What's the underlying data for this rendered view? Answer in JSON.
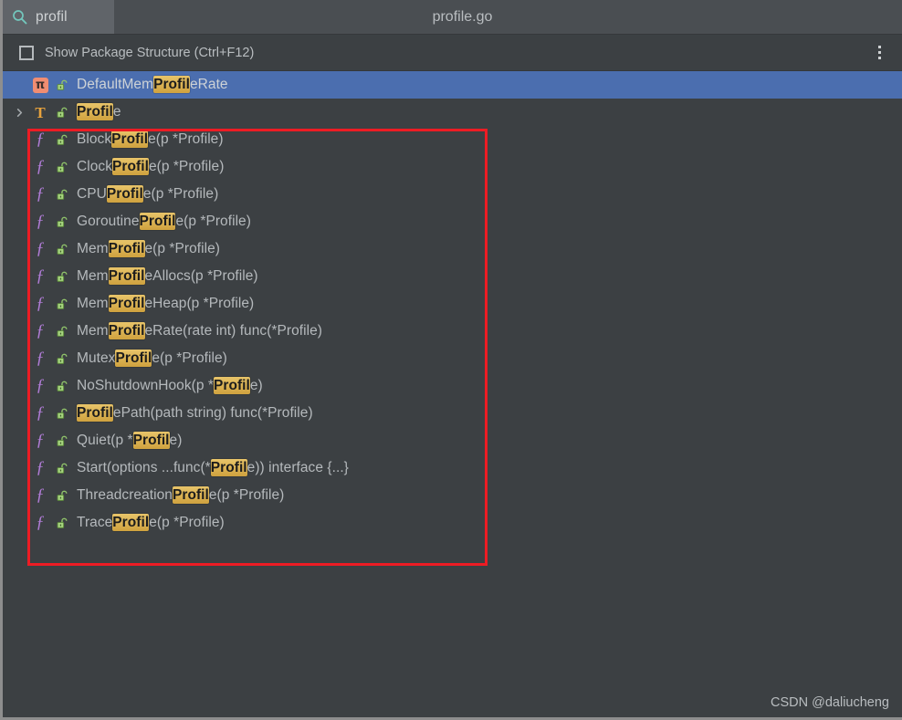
{
  "window": {
    "file_title": "profile.go",
    "background_color": "#3c4043"
  },
  "search": {
    "icon": "search-icon",
    "value": "profil",
    "placeholder": "Search"
  },
  "toolbar": {
    "checkbox_label": "Show Package Structure (Ctrl+F12)",
    "checkbox_checked": false,
    "menu_icon": "kebab-menu-icon"
  },
  "highlight_term": "Profil",
  "tree": {
    "rows": [
      {
        "kind": "constant",
        "icon": "pi-constant-icon",
        "lock": "unlock-icon",
        "twisty": "",
        "selected": true,
        "parts": [
          {
            "t": "DefaultMem",
            "h": false
          },
          {
            "t": "Profil",
            "h": true
          },
          {
            "t": "eRate",
            "h": false
          }
        ]
      },
      {
        "kind": "type",
        "icon": "type-t-icon",
        "lock": "unlock-icon",
        "twisty": "chevron-right-icon",
        "selected": false,
        "parts": [
          {
            "t": "Profil",
            "h": true
          },
          {
            "t": "e",
            "h": false
          }
        ]
      },
      {
        "kind": "function",
        "icon": "function-f-icon",
        "lock": "unlock-icon",
        "twisty": "",
        "selected": false,
        "parts": [
          {
            "t": "Block",
            "h": false
          },
          {
            "t": "Profil",
            "h": true
          },
          {
            "t": "e(p *Profile)",
            "h": false
          }
        ]
      },
      {
        "kind": "function",
        "icon": "function-f-icon",
        "lock": "unlock-icon",
        "twisty": "",
        "selected": false,
        "parts": [
          {
            "t": "Clock",
            "h": false
          },
          {
            "t": "Profil",
            "h": true
          },
          {
            "t": "e(p *Profile)",
            "h": false
          }
        ]
      },
      {
        "kind": "function",
        "icon": "function-f-icon",
        "lock": "unlock-icon",
        "twisty": "",
        "selected": false,
        "parts": [
          {
            "t": "CPU",
            "h": false
          },
          {
            "t": "Profil",
            "h": true
          },
          {
            "t": "e(p *Profile)",
            "h": false
          }
        ]
      },
      {
        "kind": "function",
        "icon": "function-f-icon",
        "lock": "unlock-icon",
        "twisty": "",
        "selected": false,
        "parts": [
          {
            "t": "Goroutine",
            "h": false
          },
          {
            "t": "Profil",
            "h": true
          },
          {
            "t": "e(p *Profile)",
            "h": false
          }
        ]
      },
      {
        "kind": "function",
        "icon": "function-f-icon",
        "lock": "unlock-icon",
        "twisty": "",
        "selected": false,
        "parts": [
          {
            "t": "Mem",
            "h": false
          },
          {
            "t": "Profil",
            "h": true
          },
          {
            "t": "e(p *Profile)",
            "h": false
          }
        ]
      },
      {
        "kind": "function",
        "icon": "function-f-icon",
        "lock": "unlock-icon",
        "twisty": "",
        "selected": false,
        "parts": [
          {
            "t": "Mem",
            "h": false
          },
          {
            "t": "Profil",
            "h": true
          },
          {
            "t": "eAllocs(p *Profile)",
            "h": false
          }
        ]
      },
      {
        "kind": "function",
        "icon": "function-f-icon",
        "lock": "unlock-icon",
        "twisty": "",
        "selected": false,
        "parts": [
          {
            "t": "Mem",
            "h": false
          },
          {
            "t": "Profil",
            "h": true
          },
          {
            "t": "eHeap(p *Profile)",
            "h": false
          }
        ]
      },
      {
        "kind": "function",
        "icon": "function-f-icon",
        "lock": "unlock-icon",
        "twisty": "",
        "selected": false,
        "parts": [
          {
            "t": "Mem",
            "h": false
          },
          {
            "t": "Profil",
            "h": true
          },
          {
            "t": "eRate(rate int) func(*Profile)",
            "h": false
          }
        ]
      },
      {
        "kind": "function",
        "icon": "function-f-icon",
        "lock": "unlock-icon",
        "twisty": "",
        "selected": false,
        "parts": [
          {
            "t": "Mutex",
            "h": false
          },
          {
            "t": "Profil",
            "h": true
          },
          {
            "t": "e(p *Profile)",
            "h": false
          }
        ]
      },
      {
        "kind": "function",
        "icon": "function-f-icon",
        "lock": "unlock-icon",
        "twisty": "",
        "selected": false,
        "parts": [
          {
            "t": "NoShutdownHook(p *",
            "h": false
          },
          {
            "t": "Profil",
            "h": true
          },
          {
            "t": "e)",
            "h": false
          }
        ]
      },
      {
        "kind": "function",
        "icon": "function-f-icon",
        "lock": "unlock-icon",
        "twisty": "",
        "selected": false,
        "parts": [
          {
            "t": "Profil",
            "h": true
          },
          {
            "t": "ePath(path string) func(*Profile)",
            "h": false
          }
        ]
      },
      {
        "kind": "function",
        "icon": "function-f-icon",
        "lock": "unlock-icon",
        "twisty": "",
        "selected": false,
        "parts": [
          {
            "t": "Quiet(p *",
            "h": false
          },
          {
            "t": "Profil",
            "h": true
          },
          {
            "t": "e)",
            "h": false
          }
        ]
      },
      {
        "kind": "function",
        "icon": "function-f-icon",
        "lock": "unlock-icon",
        "twisty": "",
        "selected": false,
        "parts": [
          {
            "t": "Start(options ...func(*",
            "h": false
          },
          {
            "t": "Profil",
            "h": true
          },
          {
            "t": "e)) interface {...}",
            "h": false
          }
        ]
      },
      {
        "kind": "function",
        "icon": "function-f-icon",
        "lock": "unlock-icon",
        "twisty": "",
        "selected": false,
        "parts": [
          {
            "t": "Threadcreation",
            "h": false
          },
          {
            "t": "Profil",
            "h": true
          },
          {
            "t": "e(p *Profile)",
            "h": false
          }
        ]
      },
      {
        "kind": "function",
        "icon": "function-f-icon",
        "lock": "unlock-icon",
        "twisty": "",
        "selected": false,
        "parts": [
          {
            "t": "Trace",
            "h": false
          },
          {
            "t": "Profil",
            "h": true
          },
          {
            "t": "e(p *Profile)",
            "h": false
          }
        ]
      }
    ]
  },
  "annotation": {
    "red_box_color": "#ed1c24",
    "covers_rows_from": 3,
    "covers_rows_to": 17
  },
  "watermark": {
    "text": "CSDN @daliucheng"
  }
}
